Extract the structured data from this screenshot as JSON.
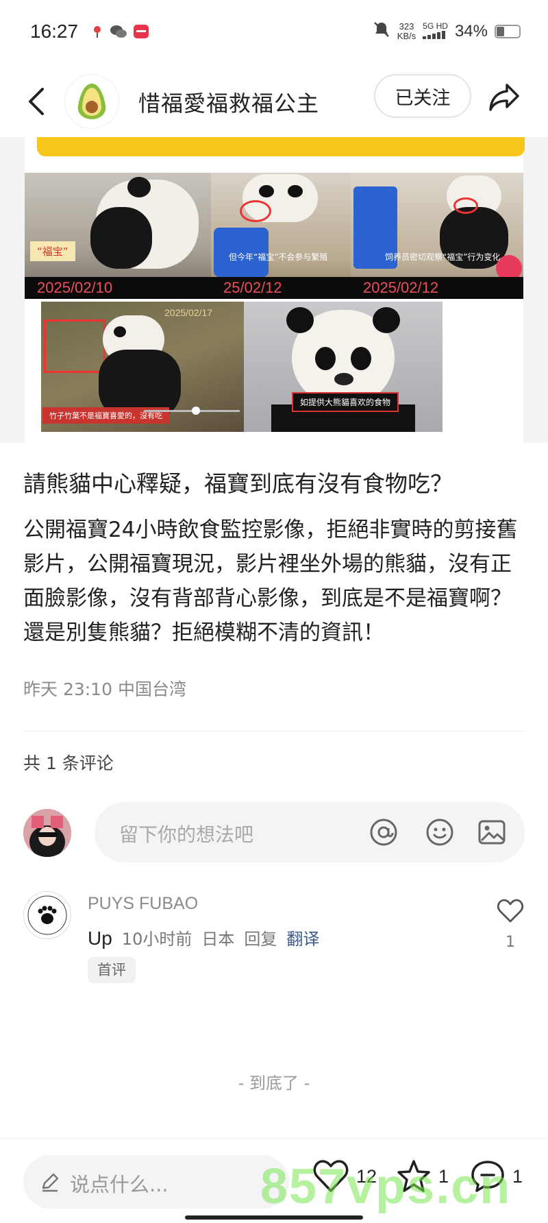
{
  "status_bar": {
    "time": "16:27",
    "net_speed_value": "323",
    "net_speed_unit": "KB/s",
    "network": "5G HD",
    "battery": "34%",
    "battery_level": 0.34
  },
  "header": {
    "title": "惜福愛福救福公主",
    "follow_label": "已关注"
  },
  "collage": {
    "frames": [
      {
        "date": "2025/02/10",
        "overlay": "“福宝”"
      },
      {
        "date": "25/02/12",
        "overlay": "但今年“福宝”不会参与繁殖"
      },
      {
        "date": "2025/02/12",
        "overlay": "饲养员密切观察“福宝”行为变化"
      },
      {
        "date": "2025/02/17",
        "overlay": "竹子竹葉不是福寶喜愛的，沒有吃"
      },
      {
        "overlay": "如提供大熊貓喜欢的食物"
      }
    ]
  },
  "post": {
    "title": "請熊貓中心釋疑，福寶到底有沒有食物吃？",
    "body": "公開福寶24小時飲食監控影像，拒絕非實時的剪接舊影片，公開福寶現況，影片裡坐外場的熊貓，沒有正面臉影像，沒有背部背心影像，到底是不是福寶啊？還是別隻熊貓？拒絕模糊不清的資訊！",
    "meta": "昨天 23:10 中国台湾"
  },
  "comments": {
    "count_label": "共 1 条评论",
    "input_placeholder": "留下你的想法吧",
    "items": [
      {
        "author": "PUYS FUBAO",
        "text": "Up",
        "time": "10小时前",
        "location": "日本",
        "reply": "回复",
        "translate": "翻译",
        "badge": "首评",
        "likes": "1"
      }
    ]
  },
  "end_mark": "- 到底了 -",
  "bottom_bar": {
    "input_placeholder": "说点什么...",
    "likes": "12",
    "favorites": "1",
    "comments": "1"
  },
  "watermark": "857vps.cn",
  "colors": {
    "accent_yellow": "#f8c61a",
    "date_red": "#f04e5a",
    "translate_blue": "#3a5a8c"
  }
}
